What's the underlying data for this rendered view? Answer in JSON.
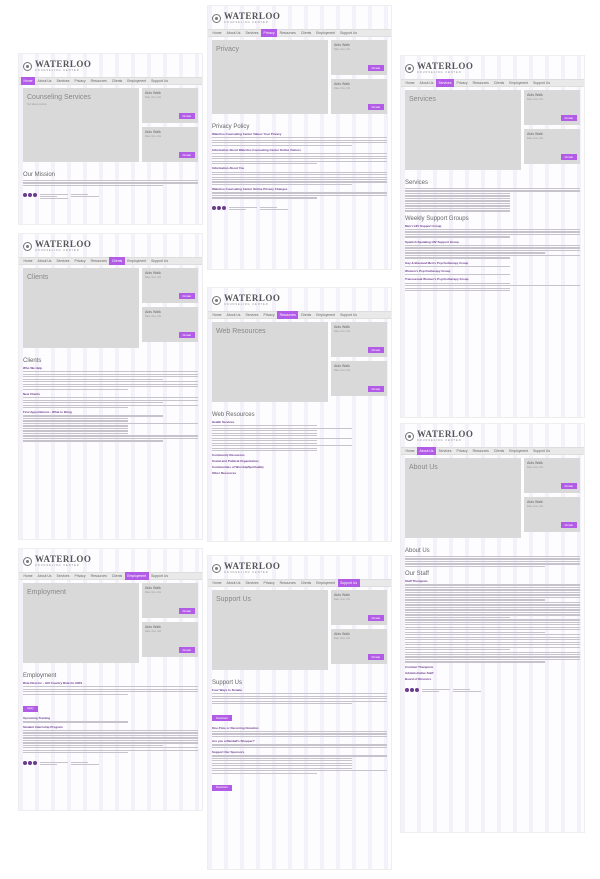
{
  "brand": {
    "name": "WATERLOO",
    "tagline": "COUNSELING CENTER"
  },
  "nav": [
    "Home",
    "About Us",
    "Services",
    "Privacy",
    "Resources",
    "Clients",
    "Employment",
    "Support Us"
  ],
  "sidebar": {
    "title": "Aids Walk",
    "subtitle": "Date, time, info",
    "button": "Donate"
  },
  "pages": {
    "home": {
      "hero": "Counseling Services",
      "hero_sub": "Our latest events",
      "heading": "Our Mission"
    },
    "privacy": {
      "hero": "Privacy",
      "heading": "Privacy Policy",
      "s1": "Waterloo Counseling Center Values Your Privacy",
      "s2": "Information About Waterloo Counseling Center Online Visitors",
      "s3": "Information About You",
      "s4": "Waterloo Counseling Center Online Privacy Changes"
    },
    "services": {
      "hero": "Services",
      "heading": "Services",
      "h2": "Weekly Support Groups",
      "g1": "Men's HIV Support Group",
      "g2": "Spanish Speaking HIV Support Group",
      "g3": "Gay & Bisexual Men's Psychotherapy Group",
      "g4": "Women's Psychotherapy Group",
      "g5": "Transsexual Women's Psychotherapy Group"
    },
    "clients": {
      "hero": "Clients",
      "heading": "Clients",
      "s1": "Who We Help",
      "s2": "New Clients",
      "s3": "First Appointment – What to Bring"
    },
    "resources": {
      "hero": "Web Resources",
      "heading": "Web Resources",
      "s1": "Health Services",
      "s2": "Community Resources",
      "s3": "Social and Political Organization",
      "s4": "Communities of Worship/Spirituality",
      "s5": "Other Resources"
    },
    "about": {
      "hero": "About Us",
      "heading": "About Us",
      "h2": "Our Staff",
      "s1": "Staff Therapists",
      "s2": "Contract Therapists",
      "s3": "Administrative Staff",
      "s4": "Board of Directors"
    },
    "employment": {
      "hero": "Employment",
      "heading": "Employment",
      "s1": "Ride Director – Hill Country Ride for AIDS",
      "apply": "Apply",
      "s2": "Upcoming Training",
      "s3": "Student Internship Program"
    },
    "support": {
      "hero": "Support Us",
      "heading": "Support Us",
      "s1": "Four Ways to Donate",
      "s2": "One-Time or Recurring Donation",
      "s3": "Are you a Randall's Shopper?",
      "s4": "Support Our Sponsors",
      "download": "Download"
    }
  }
}
